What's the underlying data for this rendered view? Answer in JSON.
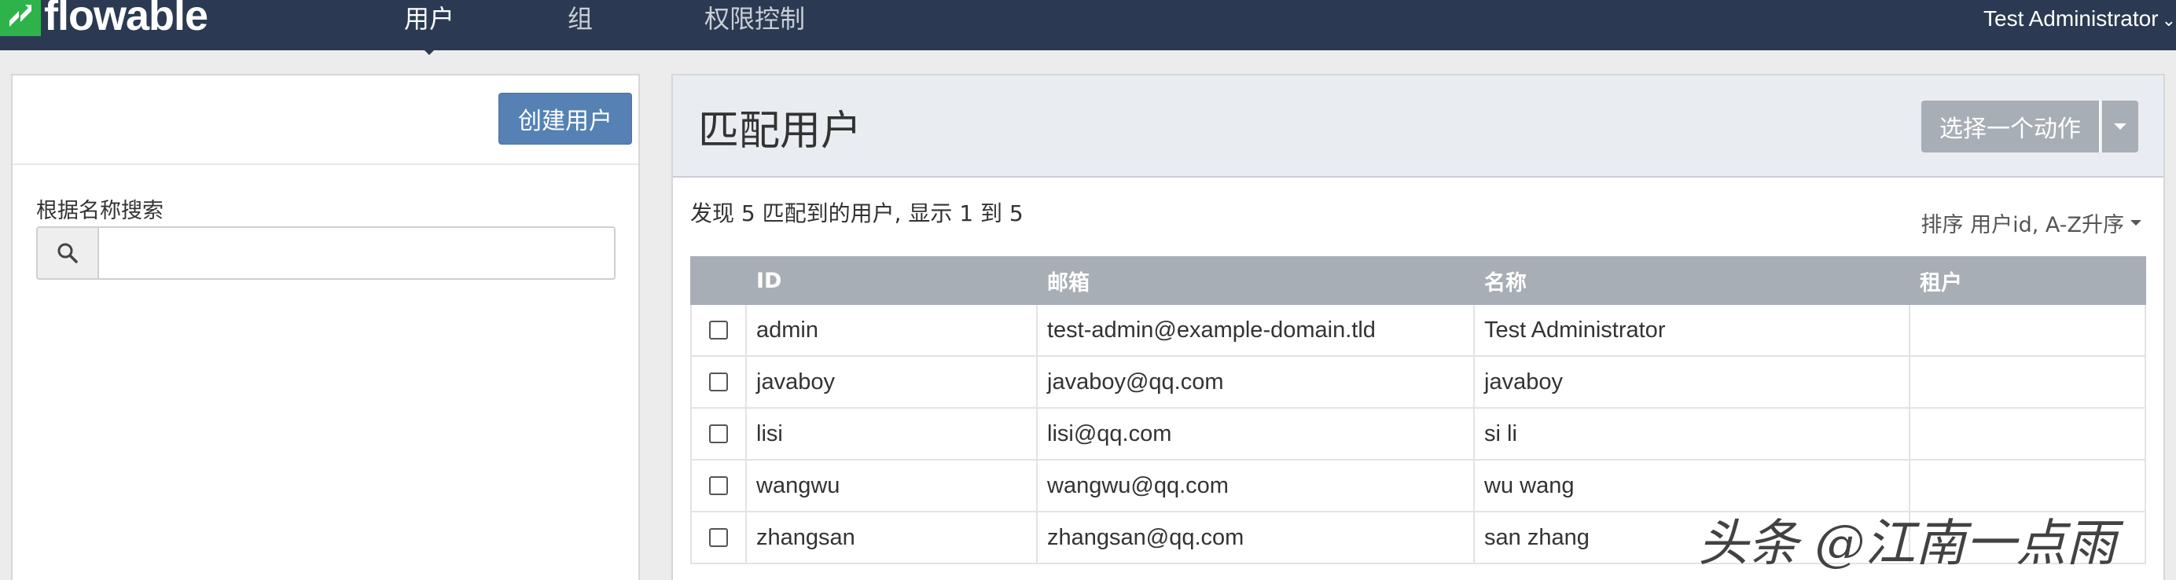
{
  "navbar": {
    "logo_text": "flowable",
    "tabs": [
      {
        "label": "用户",
        "active": true
      },
      {
        "label": "组",
        "active": false
      },
      {
        "label": "权限控制",
        "active": false
      }
    ],
    "user_menu": "Test Administrator"
  },
  "left_panel": {
    "create_button": "创建用户",
    "search_label": "根据名称搜索",
    "search_value": "",
    "search_placeholder": ""
  },
  "right_panel": {
    "title": "匹配用户",
    "action_button": "选择一个动作",
    "result_summary": "发现 5 匹配到的用户, 显示 1 到 5",
    "sort_label": "排序 用户id, A-Z升序",
    "table": {
      "headers": [
        "",
        "ID",
        "邮箱",
        "名称",
        "租户"
      ],
      "rows": [
        {
          "id": "admin",
          "email": "test-admin@example-domain.tld",
          "name": "Test Administrator",
          "tenant": ""
        },
        {
          "id": "javaboy",
          "email": "javaboy@qq.com",
          "name": "javaboy",
          "tenant": ""
        },
        {
          "id": "lisi",
          "email": "lisi@qq.com",
          "name": "si li",
          "tenant": ""
        },
        {
          "id": "wangwu",
          "email": "wangwu@qq.com",
          "name": "wu wang",
          "tenant": ""
        },
        {
          "id": "zhangsan",
          "email": "zhangsan@qq.com",
          "name": "san zhang",
          "tenant": ""
        }
      ]
    }
  },
  "watermark": "头条 @江南一点雨",
  "colors": {
    "navbar_bg": "#2b3a52",
    "primary_button": "#5581b5",
    "header_gray": "#a8aeb5",
    "logo_green": "#2db34a"
  }
}
